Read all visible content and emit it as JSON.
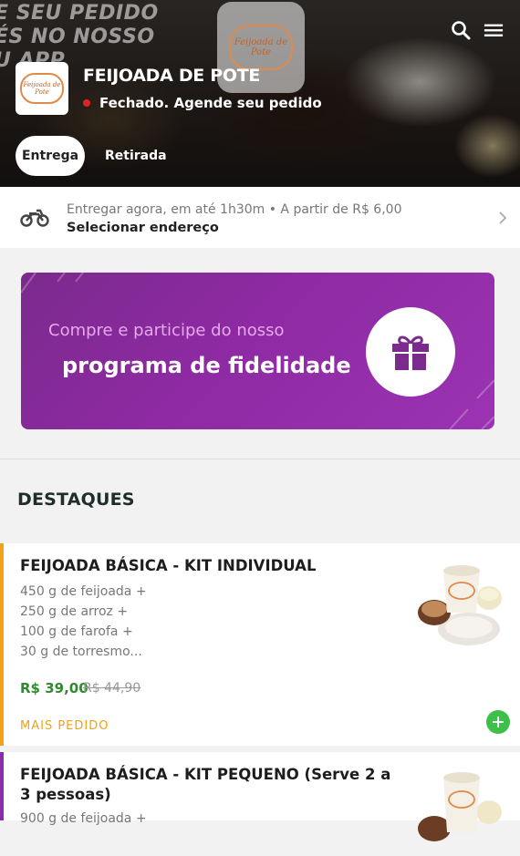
{
  "header": {
    "overlay_lines": [
      "E SEU PEDIDO",
      "ÉS NO NOSSO",
      "U APP"
    ],
    "logo_text": "Feijoada de Pote",
    "store_name": "FEIJOADA DE POTE",
    "status": "Fechado. Agende seu pedido",
    "status_color": "#e02424",
    "icons": [
      "search-icon",
      "menu-icon"
    ],
    "tabs": [
      {
        "label": "Entrega",
        "active": true
      },
      {
        "label": "Retirada",
        "active": false
      }
    ]
  },
  "delivery": {
    "line1": "Entregar agora, em até 1h30m • A partir de R$ 6,00",
    "line2": "Selecionar endereço",
    "icon": "motorcycle-icon"
  },
  "banner": {
    "line1": "Compre e participe do nosso",
    "line2": "programa de fidelidade",
    "icon": "gift-icon",
    "color": "#8e2aa3"
  },
  "section": {
    "title": "DESTAQUES"
  },
  "products": [
    {
      "title": "FEIJOADA BÁSICA - KIT INDIVIDUAL",
      "description": [
        "450 g de feijoada +",
        "250 g de arroz +",
        "100 g de farofa +",
        "30 g de torresmo..."
      ],
      "price": "R$ 39,00",
      "old_price": "R$ 44,90",
      "badge": "MAIS PEDIDO",
      "accent": "#f3a116"
    },
    {
      "title": "FEIJOADA BÁSICA - KIT PEQUENO (Serve 2 a 3 pessoas)",
      "description": [
        "900 g de feijoada +"
      ],
      "accent": "#8a2ab0"
    }
  ]
}
